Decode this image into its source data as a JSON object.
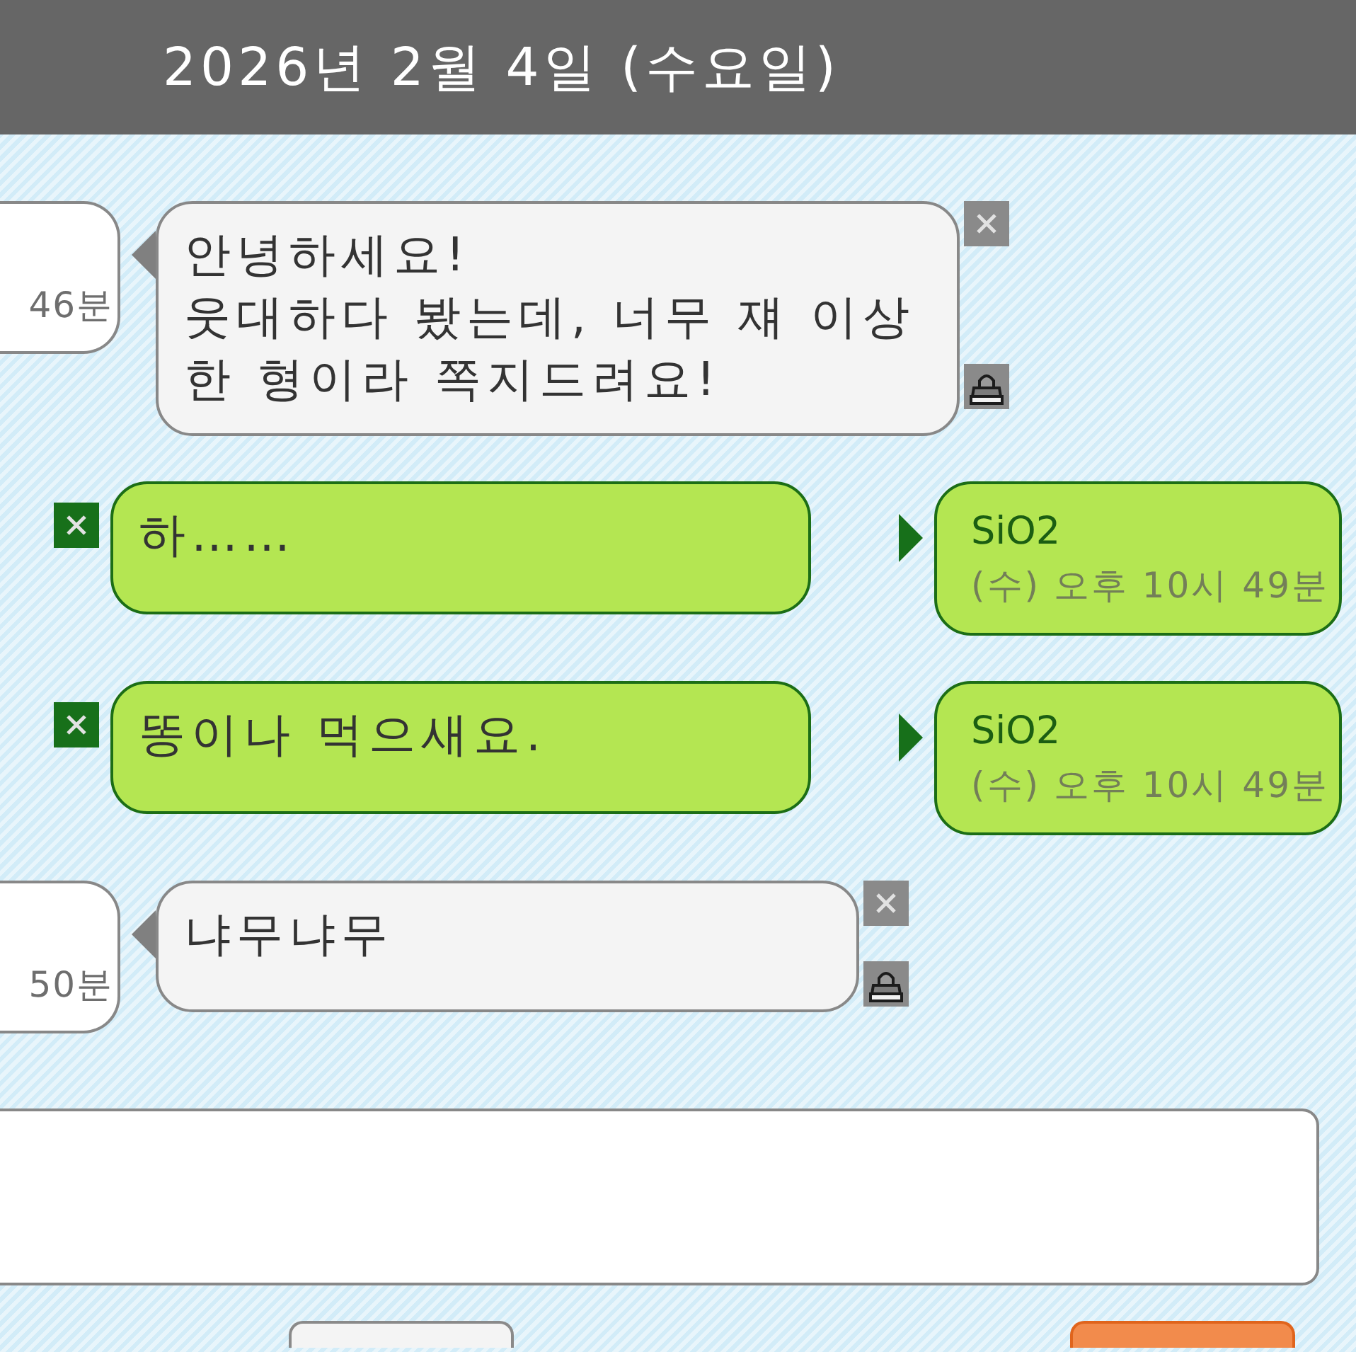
{
  "header": {
    "date": "2026년 2월 4일 (수요일)"
  },
  "messages": [
    {
      "kind": "received",
      "time": "46분",
      "text": "안녕하세요!\n웃대하다 봤는데, 너무 쟤 이상\n한 형이라 쪽지드려요!"
    },
    {
      "kind": "sent",
      "text": "하……",
      "sender": "SiO2",
      "time": "(수) 오후 10시 49분"
    },
    {
      "kind": "sent",
      "text": "똥이나 먹으새요.",
      "sender": "SiO2",
      "time": "(수) 오후 10시 49분"
    },
    {
      "kind": "received",
      "time": "50분",
      "text": "냐무냐무"
    }
  ],
  "footer_buttons": [
    {
      "kind": "secondary"
    },
    {
      "kind": "primary"
    }
  ]
}
